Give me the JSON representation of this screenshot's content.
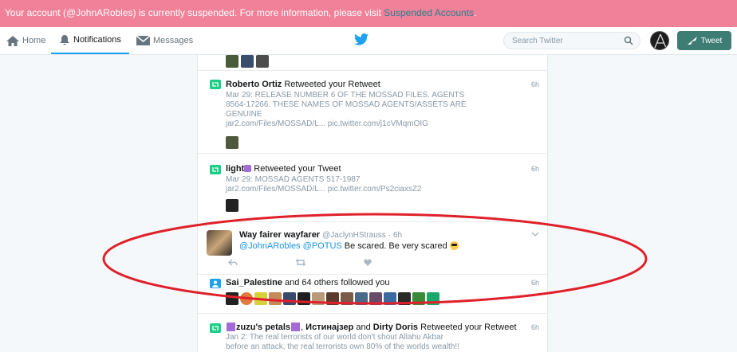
{
  "banner": {
    "text": "Your account (@JohnARobles) is currently suspended. For more information, please visit ",
    "link": "Suspended Accounts",
    "end": "."
  },
  "nav": {
    "home": "Home",
    "notifications": "Notifications",
    "messages": "Messages",
    "search_placeholder": "Search Twitter",
    "tweet_button": "Tweet"
  },
  "notifications": [
    {
      "name": "Roberto Ortiz",
      "action": " Retweeted your Retweet",
      "time": "6h",
      "lines": [
        "Mar 29: RELEASE NUMBER 6 OF THE MOSSAD FILES. AGENTS",
        "8564-17266. THESE NAMES OF MOSSAD AGENTS/ASSETS ARE",
        "GENUINE",
        "jar2.com/Files/MOSSAD/L...  pic.twitter.com/j1cVMqmOIG"
      ]
    },
    {
      "name": "light",
      "action": " Retweeted your Tweet",
      "time": "6h",
      "lines": [
        "Mar 29: MOSSAD AGENTS 517-1987",
        "jar2.com/Files/MOSSAD/L...  pic.twitter.com/Ps2ciaxsZ2"
      ]
    },
    {
      "name": "Way fairer wayfarer",
      "handle": "@JaclynHStrauss",
      "time": "· 6h",
      "mention1": "@JohnARobles",
      "mention2": "@POTUS",
      "text": " Be scared. Be very scared "
    },
    {
      "name": "Sai_Palestine",
      "action": " and 64 others followed you",
      "time": "6h"
    },
    {
      "name1": "zuzu's petals",
      "sep": ", ",
      "name2": "Истинаjзер",
      "and": " and ",
      "name3": "Dirty Doris",
      "action": " Retweeted your Retweet",
      "time": "6h",
      "lines": [
        "Jan 2: The real terrorists of our world don't shout Allahu Akbar",
        "before an attack, the real terrorists own 80% of the worlds wealth!!"
      ]
    }
  ],
  "colors": {
    "banner": "#f08198",
    "accent": "#1da1f2",
    "retweet": "#19cf86",
    "annotation": "#e0202a"
  }
}
